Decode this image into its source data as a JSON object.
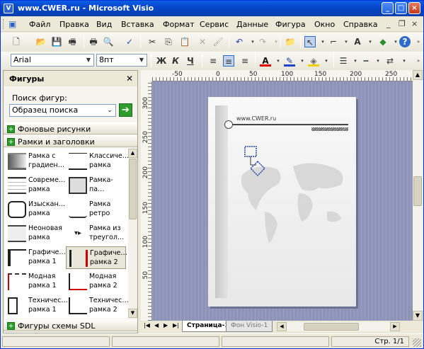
{
  "window": {
    "title": "www.CWER.ru - Microsoft Visio"
  },
  "menu": {
    "items": [
      "Файл",
      "Правка",
      "Вид",
      "Вставка",
      "Формат",
      "Сервис",
      "Данные",
      "Фигура",
      "Окно",
      "Справка"
    ]
  },
  "formatting": {
    "font": "Arial",
    "size": "8пт",
    "bold": "Ж",
    "italic": "К",
    "underline": "Ч"
  },
  "sidebar": {
    "title": "Фигуры",
    "search_label": "Поиск фигур:",
    "search_placeholder": "Образец поиска",
    "stencils": [
      {
        "label": "Фоновые рисунки"
      },
      {
        "label": "Рамки и заголовки"
      },
      {
        "label": "Фигуры схемы SDL"
      }
    ],
    "shapes": [
      {
        "label": "Рамка с градиен…"
      },
      {
        "label": "Классиче… рамка"
      },
      {
        "label": "Совреме… рамка"
      },
      {
        "label": "Рамка-па…"
      },
      {
        "label": "Изыскан… рамка"
      },
      {
        "label": "Рамка ретро"
      },
      {
        "label": "Неоновая рамка"
      },
      {
        "label": "Рамка из треугол…"
      },
      {
        "label": "Графиче… рамка 1"
      },
      {
        "label": "Графиче… рамка 2"
      },
      {
        "label": "Модная рамка 1"
      },
      {
        "label": "Модная рамка 2"
      },
      {
        "label": "Техничес… рамка 1"
      },
      {
        "label": "Техничес… рамка 2"
      }
    ]
  },
  "ruler": {
    "h_ticks": [
      "-50",
      "0",
      "50",
      "100",
      "150",
      "200",
      "250"
    ],
    "v_ticks": [
      "300",
      "250",
      "200",
      "150",
      "100",
      "50"
    ]
  },
  "page": {
    "header_text": "www.CWER.ru"
  },
  "tabs": [
    {
      "label": "Страница-1"
    },
    {
      "label": "Фон Visio-1"
    }
  ],
  "status": {
    "page": "Стр. 1/1"
  }
}
